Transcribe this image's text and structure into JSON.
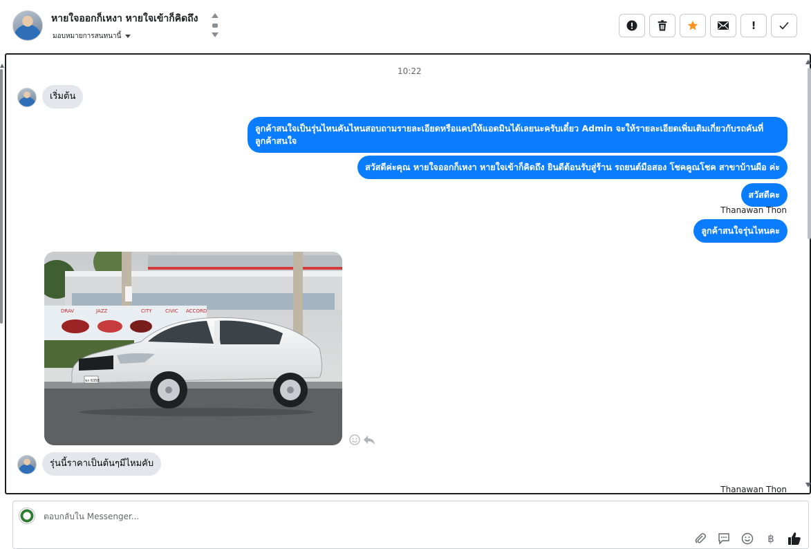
{
  "header": {
    "conversation_name": "หายใจออกก็เหงา หายใจเข้าก็คิดถึง",
    "assign_label": "มอบหมายการสนทนานี้",
    "actions": [
      {
        "name": "spam-button",
        "icon": "alert-circle-icon"
      },
      {
        "name": "delete-button",
        "icon": "trash-icon"
      },
      {
        "name": "star-button",
        "icon": "star-icon"
      },
      {
        "name": "mark-unread-button",
        "icon": "envelope-icon"
      },
      {
        "name": "follow-up-button",
        "icon": "exclamation-icon",
        "glyph": "!"
      },
      {
        "name": "mark-done-button",
        "icon": "check-icon"
      }
    ],
    "star_color": "#f7931e"
  },
  "conversation": {
    "timestamp": "10:22",
    "messages": {
      "m1": "เริ่มต้น",
      "m2": "ลูกค้าสนใจเป็นรุ่นไหนคันไหนสอบถามรายละเอียดหรือแคปให้แอดมินได้เลยนะครับเดี๋ยว Admin จะให้รายละเอียดเพิ่มเติมเกี่ยวกับรถคันที่ลูกค้าสนใจ",
      "m3": "สวัสดีค่ะคุณ หายใจออกก็เหงา หายใจเข้าก็คิดถึง ยินดีต้อนรับสู่ร้าน รถยนต์มือสอง โชคคูณโชค สาขาบ้านผือ ค่ะ",
      "m4": "สวัสดีคะ",
      "m5": "ลูกค้าสนใจรุ่นไหนคะ",
      "m6": "รุ่นนี้ราคาเป็นต้นๆมีไหมคับ"
    },
    "sender_label_1": "Thanawan Thon",
    "sender_label_2": "Thanawan Thon",
    "photo": {
      "plate_text": "ขก 6358",
      "signs": [
        "DRAV",
        "JAZZ",
        "CIVIC",
        "ACCORD",
        "CITY"
      ]
    },
    "outgoing_color": "#0a7cff",
    "incoming_color": "#e4e6eb"
  },
  "composer": {
    "placeholder": "ตอบกลับใน Messenger...",
    "value": "",
    "tools": [
      "paperclip-icon",
      "chat-bubble-icon",
      "emoji-icon",
      "baht-icon",
      "thumbs-up-icon"
    ],
    "baht_glyph": "฿"
  }
}
